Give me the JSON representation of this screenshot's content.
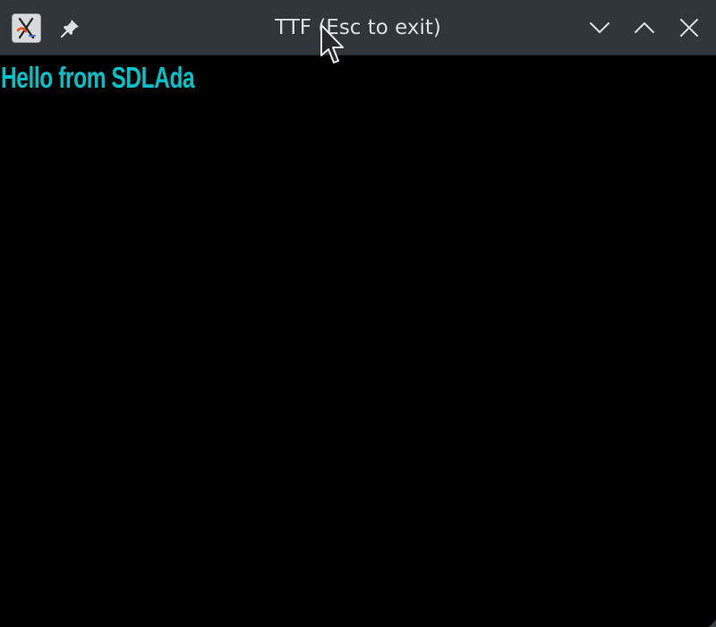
{
  "window": {
    "title": "TTF (Esc to exit)",
    "icons": {
      "app": "x-app-icon",
      "pin": "pin-icon",
      "minimize": "chevron-down-icon",
      "maximize": "chevron-up-icon",
      "close": "close-icon"
    }
  },
  "content": {
    "text": "Hello from SDLAda",
    "text_color": "#00c2c8",
    "background_color": "#000000"
  }
}
